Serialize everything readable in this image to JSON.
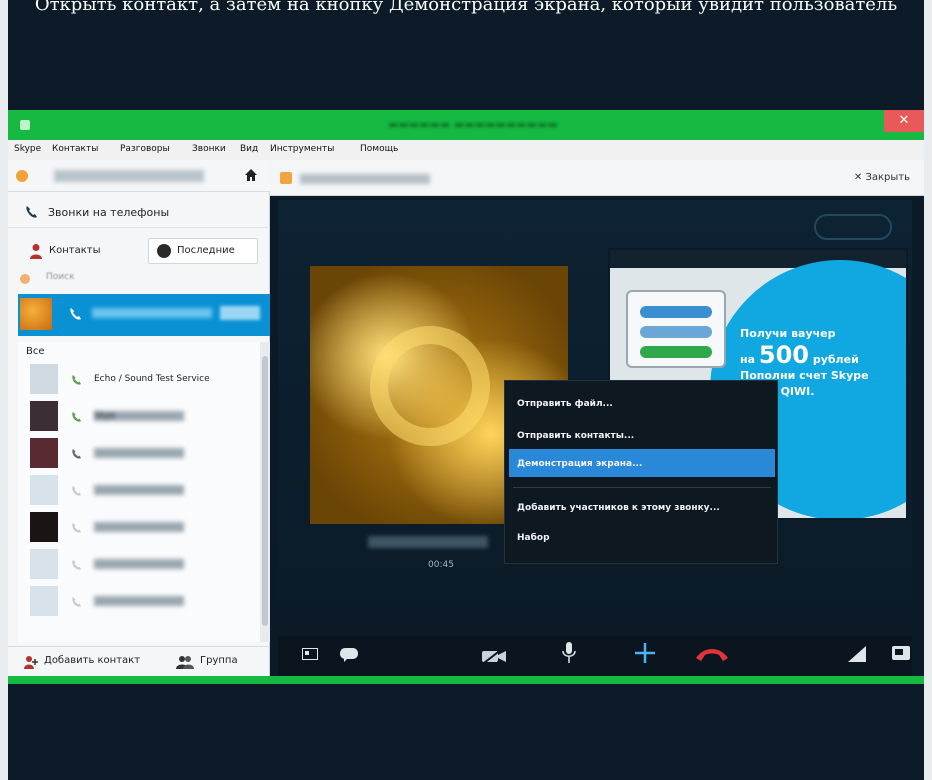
{
  "top_caption": "Открыть контакт, а затем на кнопку Демонстрация экрана, который увидит пользователь",
  "window": {
    "menu": [
      "Skype",
      "Контакты",
      "Разговоры",
      "Звонки",
      "Вид",
      "Инструменты",
      "Помощь"
    ],
    "close_glyph": "✕"
  },
  "sidebar": {
    "call_phones_label": "Звонки на телефоны",
    "tabs": {
      "contacts": "Контакты",
      "recent": "Последние"
    },
    "search_placeholder": "Поиск",
    "list_header": "Все",
    "contacts": [
      {
        "name": "Echo / Sound Test Service",
        "blurred": false,
        "avatar_color": "#cfd9e2",
        "status_color": "#5aa24b"
      },
      {
        "name": "Skye",
        "blurred": true,
        "avatar_color": "#3b2f35",
        "status_color": "#5aa24b"
      },
      {
        "name": "",
        "blurred": true,
        "avatar_color": "#5a2a32",
        "status_color": "#6a6a6a"
      },
      {
        "name": "",
        "blurred": true,
        "avatar_color": "#d7e2ea",
        "status_color": "#c5ccd2"
      },
      {
        "name": "",
        "blurred": true,
        "avatar_color": "#1a1414",
        "status_color": "#c5ccd2"
      },
      {
        "name": "",
        "blurred": true,
        "avatar_color": "#d7e2ea",
        "status_color": "#c5ccd2"
      },
      {
        "name": "",
        "blurred": true,
        "avatar_color": "#d7e2ea",
        "status_color": "#c5ccd2"
      }
    ],
    "add_contact_label": "Добавить контакт",
    "group_label": "Группа"
  },
  "main": {
    "close_label": "Закрыть",
    "video_time": "00:45",
    "ad": {
      "line1": "Получи ваучер",
      "line2_prefix": "на",
      "amount": "500",
      "line2_suffix": "рублей",
      "line3": "Пополни счет Skype",
      "line4": "через QIWI."
    },
    "context_menu": [
      "Отправить файл...",
      "Отправить контакты...",
      "Демонстрация экрана...",
      "Добавить участников к этому звонку...",
      "Набор"
    ]
  },
  "colors": {
    "window_frame": "#16b941",
    "selection": "#0a91d4",
    "menu_highlight": "#2a88d8",
    "hangup": "#e0343a"
  }
}
